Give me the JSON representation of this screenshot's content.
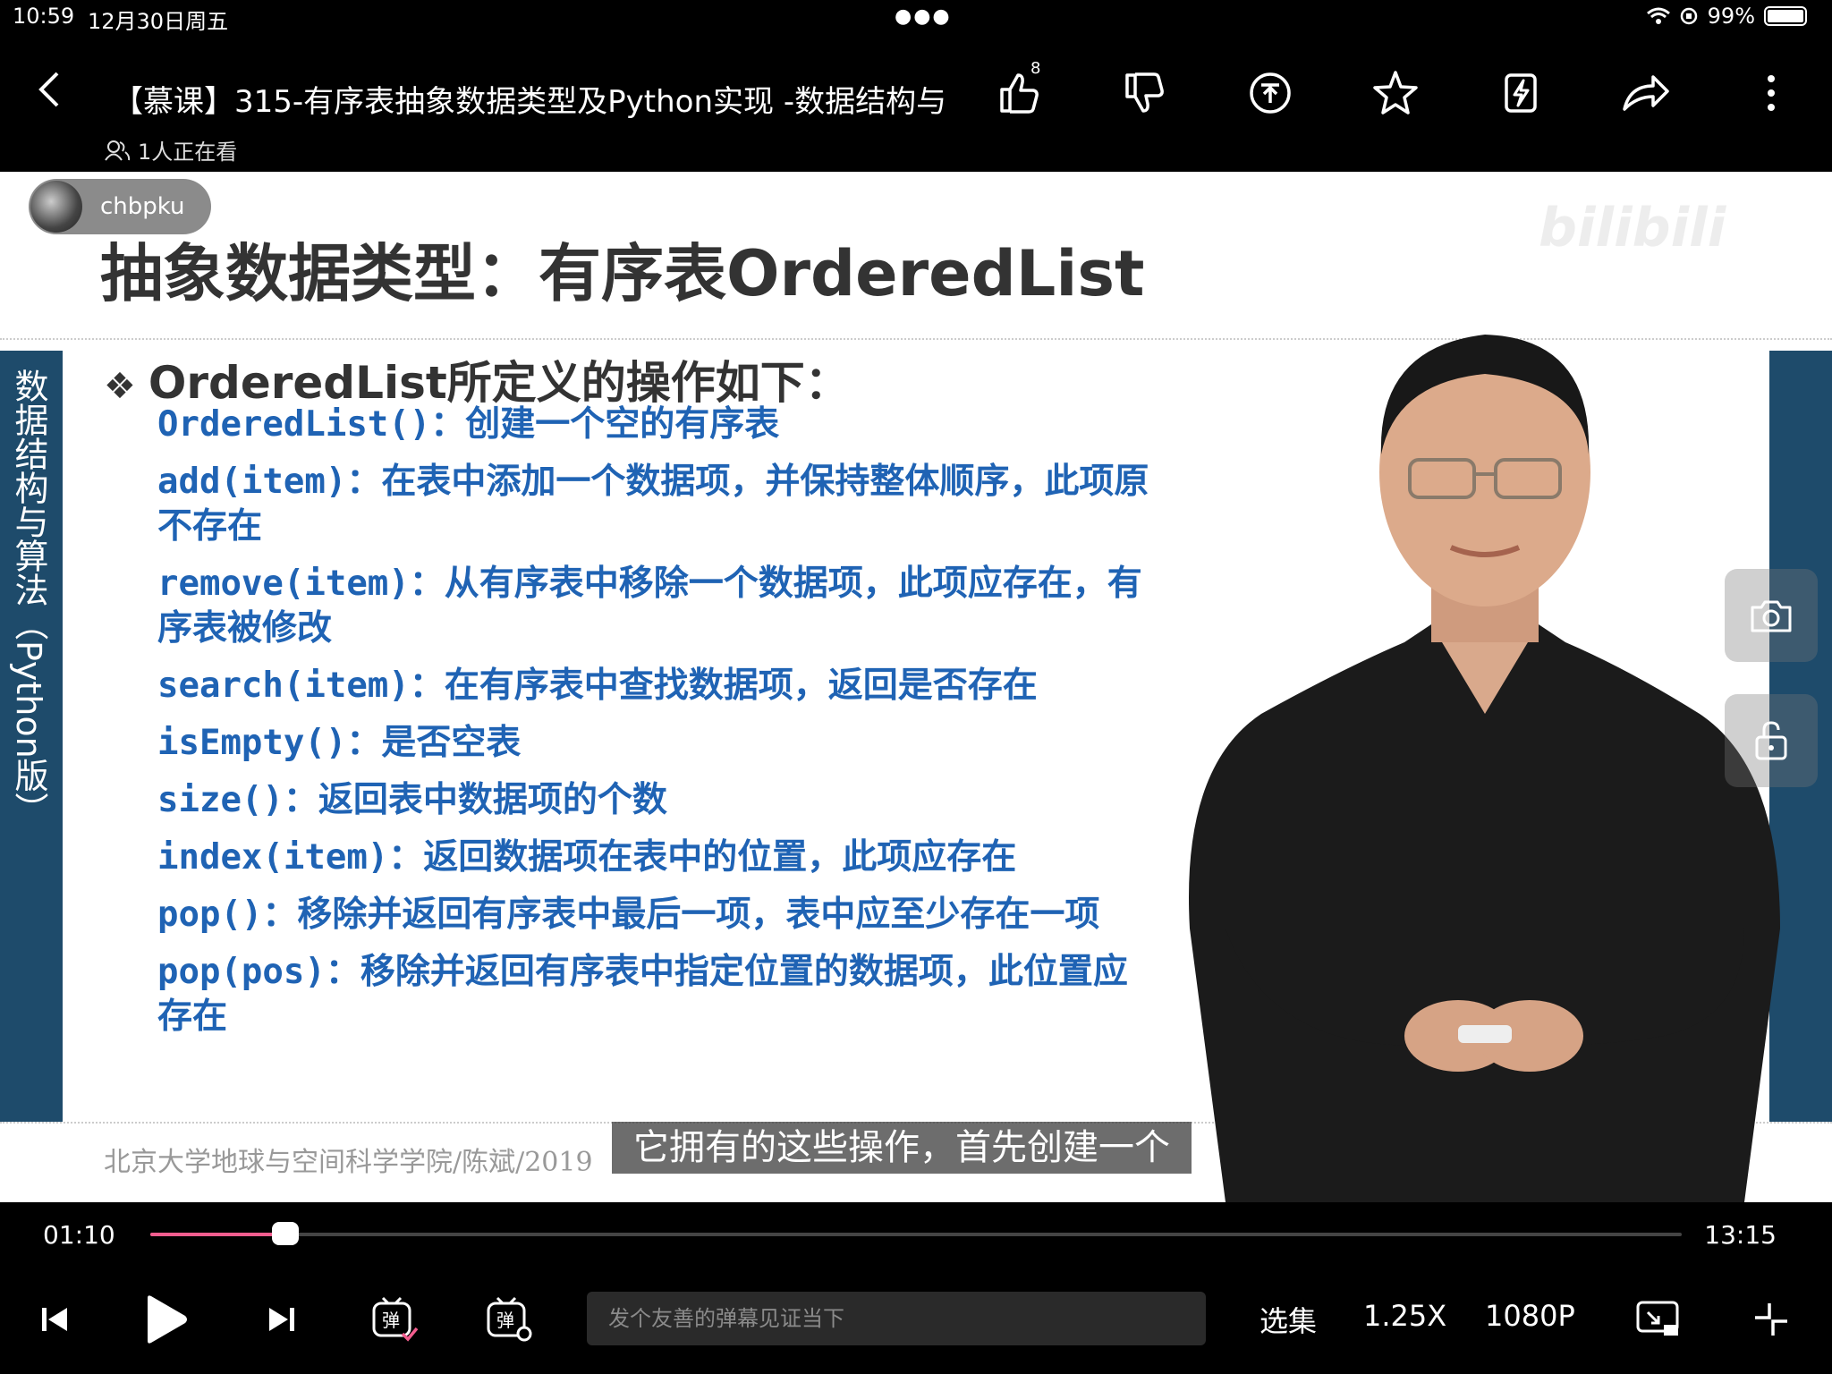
{
  "status_bar": {
    "time": "10:59",
    "date": "12月30日周五",
    "battery": "99%",
    "battery_level": 0.99
  },
  "header": {
    "back_icon": "chevron-left-icon",
    "title": "【慕课】315-有序表抽象数据类型及Python实现 -数据结构与",
    "like_count": "8",
    "watching": "1人正在看"
  },
  "video": {
    "uploader": "chbpku",
    "slide": {
      "title": "抽象数据类型：有序表OrderedList",
      "heading": "OrderedList所定义的操作如下：",
      "sidebar_text": "数据结构与算法（Python版）",
      "operations": [
        {
          "fn": "OrderedList()",
          "desc": "：创建一个空的有序表"
        },
        {
          "fn": "add(item)",
          "desc": "：在表中添加一个数据项，并保持整体顺序，此项原不存在"
        },
        {
          "fn": "remove(item)",
          "desc": "：从有序表中移除一个数据项，此项应存在，有序表被修改"
        },
        {
          "fn": "search(item)",
          "desc": "：在有序表中查找数据项，返回是否存在"
        },
        {
          "fn": "isEmpty()",
          "desc": "：是否空表"
        },
        {
          "fn": "size()",
          "desc": "：返回表中数据项的个数"
        },
        {
          "fn": "index(item)",
          "desc": "：返回数据项在表中的位置，此项应存在"
        },
        {
          "fn": "pop()",
          "desc": "：移除并返回有序表中最后一项，表中应至少存在一项"
        },
        {
          "fn": "pop(pos)",
          "desc": "：移除并返回有序表中指定位置的数据项，此位置应存在"
        }
      ],
      "footer": "北京大学地球与空间科学学院/陈斌/2019"
    },
    "subtitle": "它拥有的这些操作，首先创建一个"
  },
  "player": {
    "position": "01:10",
    "duration": "13:15",
    "progress": 0.088,
    "danmu_placeholder": "发个友善的弹幕见证当下",
    "episodes_label": "选集",
    "speed_label": "1.25X",
    "quality_label": "1080P",
    "accent_color": "#f25d8e"
  }
}
